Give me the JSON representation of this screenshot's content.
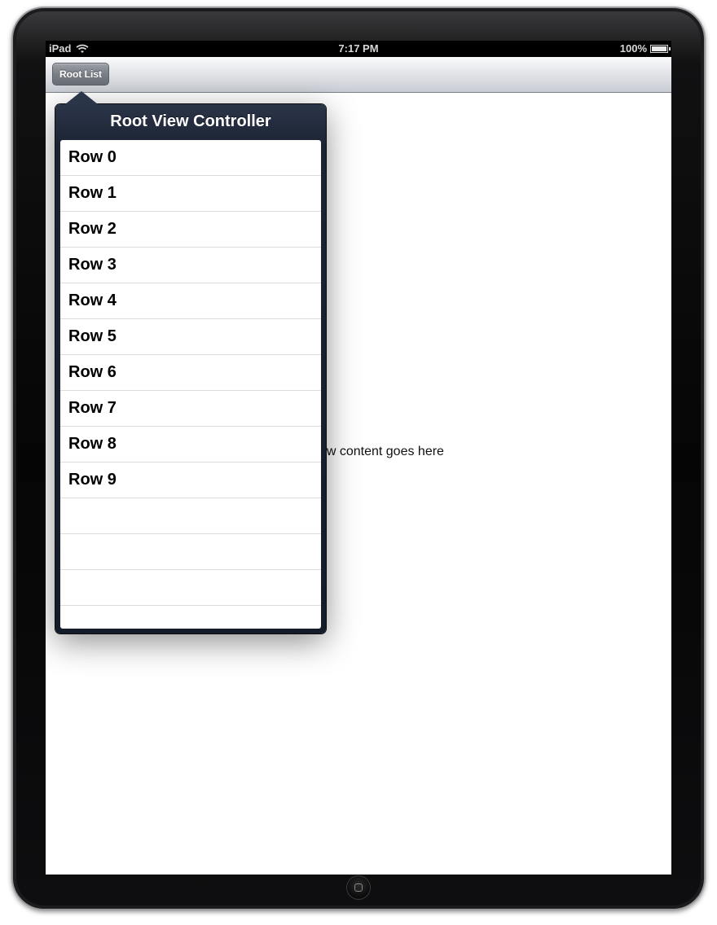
{
  "status_bar": {
    "carrier": "iPad",
    "time": "7:17 PM",
    "battery_text": "100%",
    "battery_level": 1.0
  },
  "navbar": {
    "button_label": "Root List"
  },
  "detail": {
    "label": "Detail view content goes here"
  },
  "popover": {
    "title": "Root View Controller",
    "rows": [
      "Row 0",
      "Row 1",
      "Row 2",
      "Row 3",
      "Row 4",
      "Row 5",
      "Row 6",
      "Row 7",
      "Row 8",
      "Row 9"
    ],
    "empty_rows": 3
  },
  "colors": {
    "popover_dark": "#1c2434",
    "nav_button": "#7a7e86",
    "device_bezel": "#050505"
  }
}
